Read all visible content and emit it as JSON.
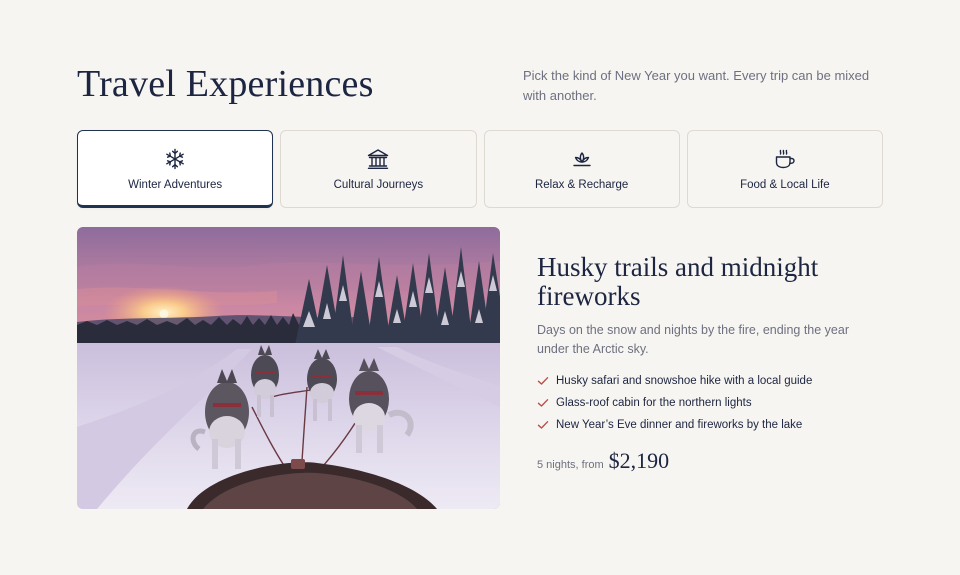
{
  "header": {
    "title": "Travel Experiences",
    "intro": "Pick the kind of New Year you want. Every trip can be mixed with another."
  },
  "tabs": [
    {
      "label": "Winter Adventures",
      "icon": "snowflake-icon",
      "active": true
    },
    {
      "label": "Cultural Journeys",
      "icon": "museum-icon",
      "active": false
    },
    {
      "label": "Relax & Recharge",
      "icon": "lotus-icon",
      "active": false
    },
    {
      "label": "Food & Local Life",
      "icon": "coffee-cup-icon",
      "active": false
    }
  ],
  "detail": {
    "image": "husky-sled-winter-sunset-photo",
    "title": "Husky trails and midnight fireworks",
    "description": "Days on the snow and nights by the fire, ending the year under the Arctic sky.",
    "highlights": [
      "Husky safari and snowshoe hike with a local guide",
      "Glass-roof cabin for the northern lights",
      "New Year’s Eve dinner and fireworks by the lake"
    ],
    "price_prefix": "5 nights, from",
    "price": "$2,190"
  },
  "colors": {
    "background": "#f7f5f1",
    "navy": "#1c2541",
    "muted": "#6d7080",
    "check": "#b5524a",
    "border": "#dedad2"
  }
}
